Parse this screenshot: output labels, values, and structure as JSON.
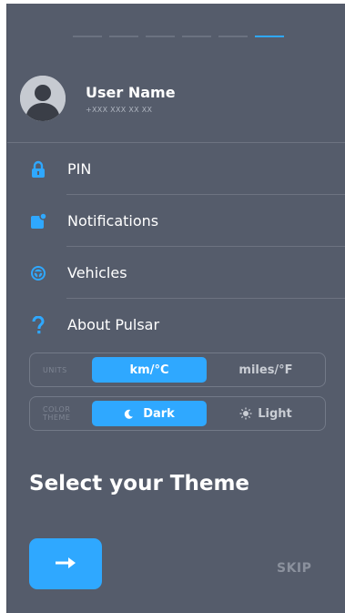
{
  "progress": {
    "steps": 6,
    "current": 6
  },
  "profile": {
    "name": "User Name",
    "phone": "+XXX XXX XX XX",
    "icon": "avatar-placeholder-icon"
  },
  "menu": {
    "items": [
      {
        "label": "PIN",
        "icon": "lock-icon"
      },
      {
        "label": "Notifications",
        "icon": "notification-icon"
      },
      {
        "label": "Vehicles",
        "icon": "steering-wheel-icon"
      },
      {
        "label": "About Pulsar",
        "icon": "question-icon"
      }
    ]
  },
  "units": {
    "label": "UNITS",
    "options": [
      "km/°C",
      "miles/°F"
    ],
    "selected": "km/°C"
  },
  "theme": {
    "label_line1": "COLOR",
    "label_line2": "THEME",
    "options": [
      "Dark",
      "Light"
    ],
    "selected": "Dark"
  },
  "title": "Select your Theme",
  "actions": {
    "next_icon": "arrow-right-icon",
    "skip_label": "SKIP"
  },
  "colors": {
    "background": "#555c6b",
    "accent": "#2fa8ff",
    "text": "#ffffff",
    "muted": "#8b919d"
  }
}
